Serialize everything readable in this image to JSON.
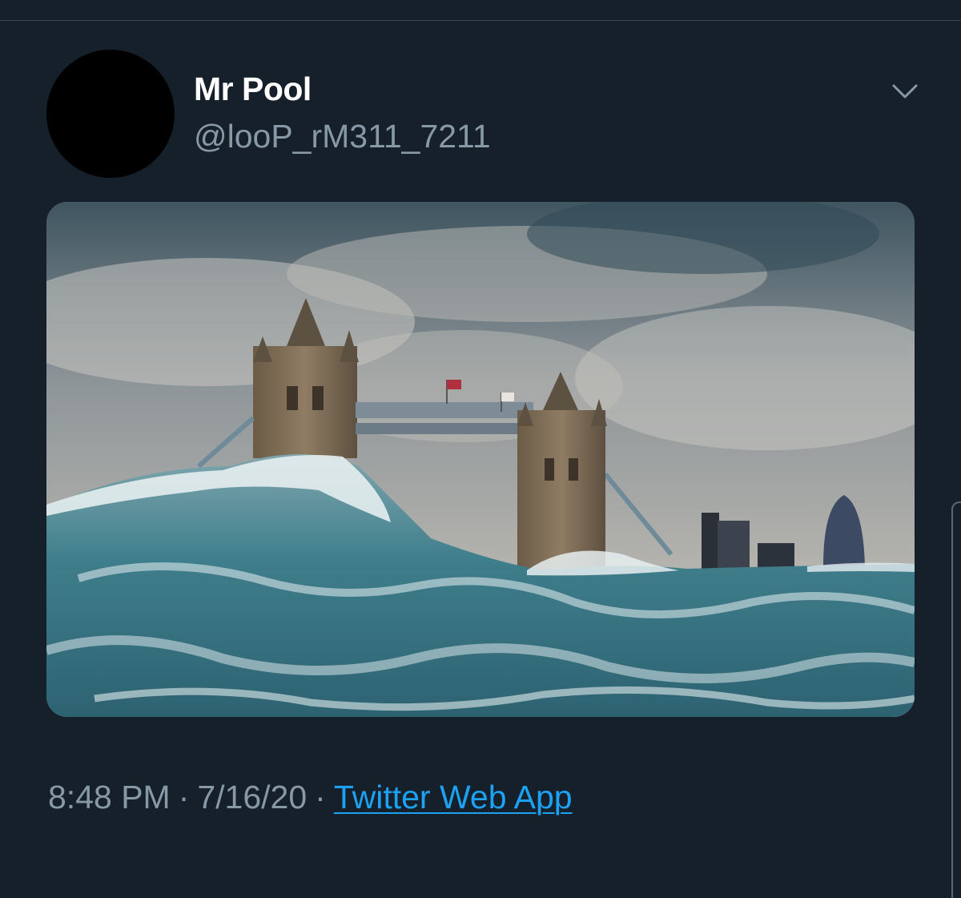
{
  "tweet": {
    "display_name": "Mr Pool",
    "handle": "@looP_rM311_7211",
    "media_description": "Tower Bridge in London engulfed by huge storm waves",
    "time": "8:48 PM",
    "separator": "·",
    "date": "7/16/20",
    "source": "Twitter Web App"
  },
  "icons": {
    "menu": "chevron-down-icon"
  },
  "colors": {
    "background": "#15202b",
    "name_text": "#ffffff",
    "secondary_text": "#8899a6",
    "link": "#1da1f2",
    "avatar": "#000000"
  }
}
